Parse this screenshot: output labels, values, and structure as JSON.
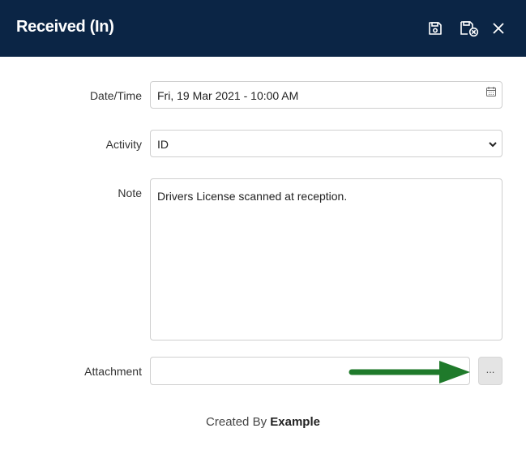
{
  "header": {
    "title": "Received (In)"
  },
  "icons": {
    "save": "save-icon",
    "save_close": "save-close-icon",
    "close": "close-icon",
    "calendar": "calendar-icon",
    "dropdown": "chevron-down-icon",
    "annotation": "green-arrow-icon"
  },
  "form": {
    "datetime": {
      "label": "Date/Time",
      "value": "Fri, 19 Mar 2021 - 10:00 AM"
    },
    "activity": {
      "label": "Activity",
      "value": "ID"
    },
    "note": {
      "label": "Note",
      "value": "Drivers License scanned at reception."
    },
    "attachment": {
      "label": "Attachment",
      "value": "",
      "browse_label": "..."
    }
  },
  "footer": {
    "created_by_label": "Created By",
    "created_by_value": "Example"
  },
  "colors": {
    "header_bg": "#0b2545",
    "arrow": "#1f7a2b"
  }
}
